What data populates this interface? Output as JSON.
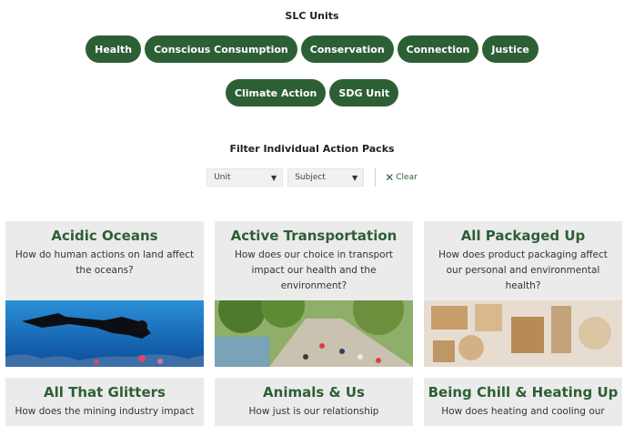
{
  "units": {
    "title": "SLC Units",
    "row1": [
      "Health",
      "Conscious Consumption",
      "Conservation",
      "Connection",
      "Justice"
    ],
    "row2": [
      "Climate Action",
      "SDG Unit"
    ]
  },
  "filters": {
    "title": "Filter Individual Action Packs",
    "unit_select": "Unit",
    "subject_select": "Subject",
    "clear_label": "Clear"
  },
  "cards": [
    {
      "title": "Acidic Oceans",
      "desc": "How do human actions on land affect the oceans?",
      "image": "scuba-diver-reef"
    },
    {
      "title": "Active Transportation",
      "desc": "How does our choice in transport impact our health and the environment?",
      "image": "cyclists-park-path"
    },
    {
      "title": "All Packaged Up",
      "desc": "How does product packaging affect our personal and environmental health?",
      "image": "cardboard-packaging"
    },
    {
      "title": "All That Glitters",
      "desc": "How does the mining industry impact"
    },
    {
      "title": "Animals & Us",
      "desc": "How just is our relationship"
    },
    {
      "title": "Being Chill & Heating Up",
      "desc": "How does heating and cooling our"
    }
  ]
}
